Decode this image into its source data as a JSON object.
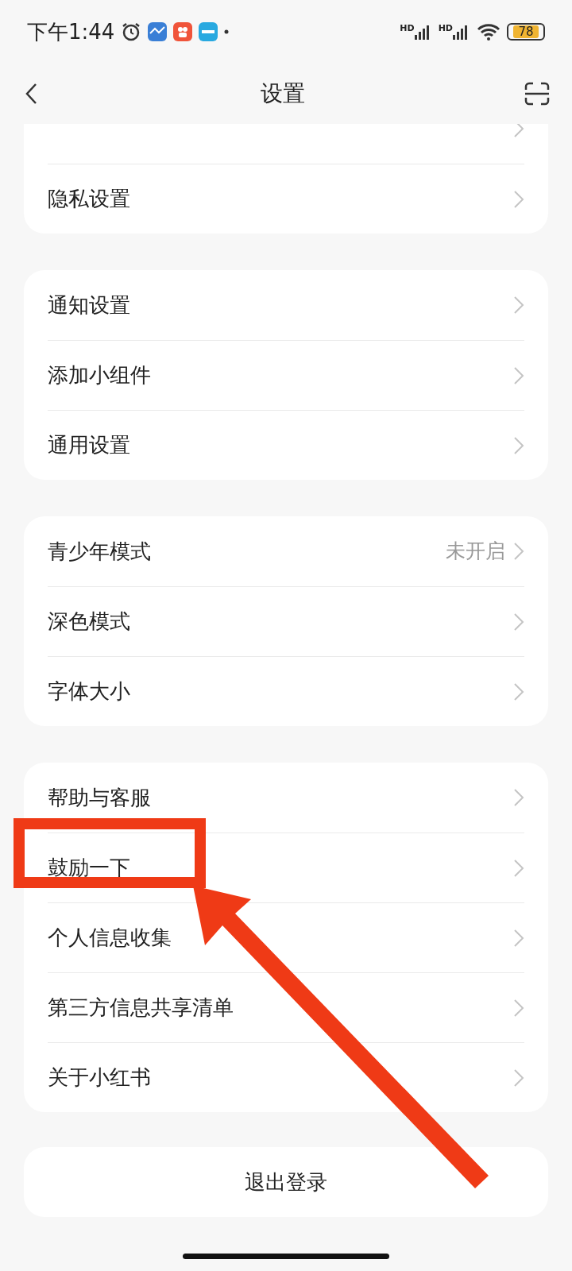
{
  "status_bar": {
    "time": "下午1:44",
    "signal_labels": [
      "HD",
      "HD"
    ],
    "battery": "78"
  },
  "header": {
    "title": "设置"
  },
  "groups": [
    {
      "cut_off_top": true,
      "items": [
        {
          "label": "隐私设置"
        }
      ]
    },
    {
      "items": [
        {
          "label": "通知设置"
        },
        {
          "label": "添加小组件"
        },
        {
          "label": "通用设置"
        }
      ]
    },
    {
      "items": [
        {
          "label": "青少年模式",
          "value": "未开启"
        },
        {
          "label": "深色模式"
        },
        {
          "label": "字体大小"
        }
      ]
    },
    {
      "items": [
        {
          "label": "帮助与客服"
        },
        {
          "label": "鼓励一下"
        },
        {
          "label": "个人信息收集"
        },
        {
          "label": "第三方信息共享清单"
        },
        {
          "label": "关于小红书"
        }
      ]
    }
  ],
  "logout": "退出登录"
}
